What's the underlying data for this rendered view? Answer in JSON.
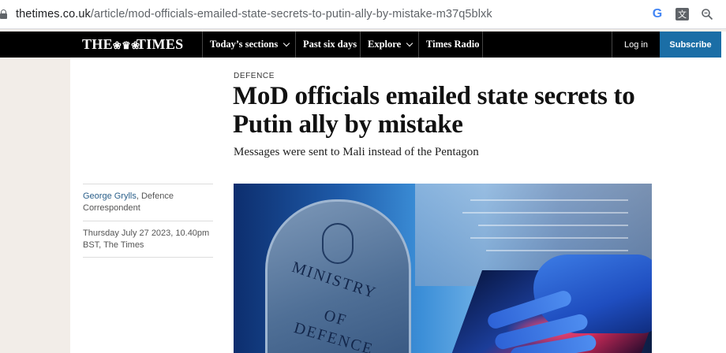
{
  "browser": {
    "url_host": "thetimes.co.uk",
    "url_path": "/article/mod-officials-emailed-state-secrets-to-putin-ally-by-mistake-m37q5blxk",
    "icons": [
      "google-icon",
      "translate-icon",
      "zoom-icon"
    ]
  },
  "nav": {
    "logo_left": "THE",
    "logo_right": "TIMES",
    "items": [
      {
        "label": "Today’s sections",
        "has_chevron": true
      },
      {
        "label": "Past six days",
        "has_chevron": false
      },
      {
        "label": "Explore",
        "has_chevron": true
      },
      {
        "label": "Times Radio",
        "has_chevron": false
      }
    ],
    "login": "Log in",
    "subscribe": "Subscribe",
    "accent_color": "#1b6ea6"
  },
  "article": {
    "section": "DEFENCE",
    "headline": "MoD officials emailed state secrets to Putin ally by mistake",
    "standfirst": "Messages were sent to Mali instead of the Pentagon",
    "author_name": "George Grylls",
    "author_role": ", Defence Correspondent",
    "date_line": "Thursday July 27 2023, 10.40pm BST, The Times"
  },
  "hero_image": {
    "sign_lines": [
      "MINISTRY",
      "OF",
      "DEFENCE"
    ]
  }
}
